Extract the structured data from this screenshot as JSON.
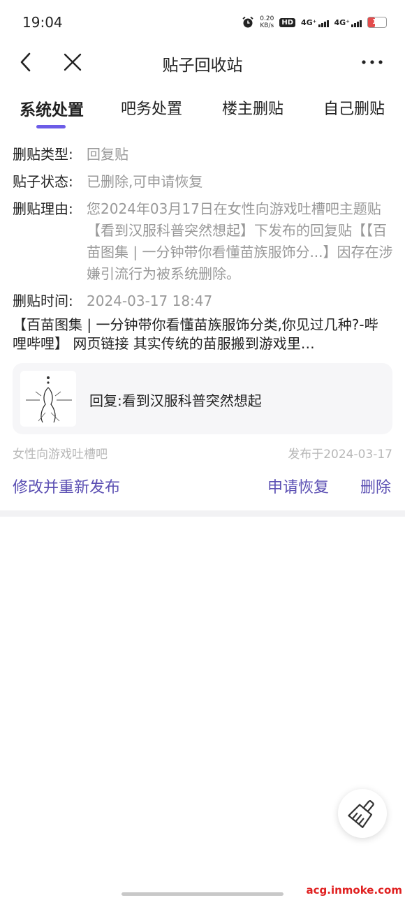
{
  "status_bar": {
    "time": "19:04",
    "net_speed_value": "0.20",
    "net_speed_unit": "KB/s",
    "hd_badge": "HD",
    "signal_1": "4G⁺",
    "signal_2": "4G⁺",
    "battery": "15",
    "icons": [
      "alarm-icon",
      "hd-icon",
      "signal-icon",
      "battery-icon"
    ]
  },
  "navbar": {
    "title": "贴子回收站",
    "icons": [
      "back-icon",
      "close-icon",
      "more-icon"
    ]
  },
  "tabs": [
    {
      "label": "系统处置",
      "active": true
    },
    {
      "label": "吧务处置",
      "active": false
    },
    {
      "label": "楼主删贴",
      "active": false
    },
    {
      "label": "自己删贴",
      "active": false
    }
  ],
  "info": {
    "type_label": "删贴类型:",
    "type_value": "回复贴",
    "status_label": "贴子状态:",
    "status_value": "已删除,可申请恢复",
    "reason_label": "删贴理由:",
    "reason_value": "您2024年03月17日在女性向游戏吐槽吧主题贴【看到汉服科普突然想起】下发布的回复贴【【百苗图集 | 一分钟带你看懂苗族服饰分...】因存在涉嫌引流行为被系统删除。",
    "time_label": "删贴时间:",
    "time_value": "2024-03-17 18:47"
  },
  "post_content": "【百苗图集 | 一分钟带你看懂苗族服饰分类,你见过几种?-哔哩哔哩】 网页链接 其实传统的苗服搬到游戏里…",
  "quote": {
    "text": "回复:看到汉服科普突然想起"
  },
  "meta": {
    "forum": "女性向游戏吐槽吧",
    "published": "发布于2024-03-17"
  },
  "actions": {
    "edit_republish": "修改并重新发布",
    "apply_restore": "申请恢复",
    "delete": "删除"
  },
  "fab": {
    "icon": "broom-icon"
  },
  "watermark": "acg.inmoke.com",
  "colors": {
    "accent": "#6c5ce7",
    "action_text": "#5b4fb3",
    "muted": "#999999",
    "battery_low": "#e34c4c"
  }
}
